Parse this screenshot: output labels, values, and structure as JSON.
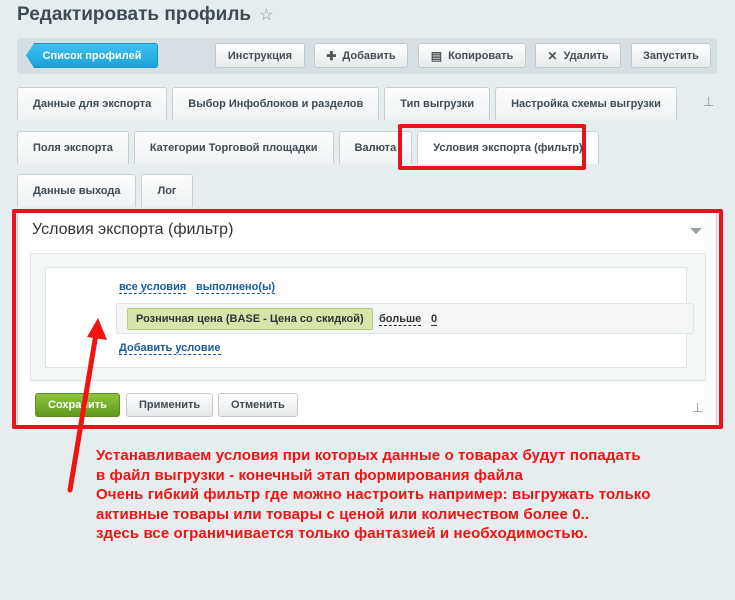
{
  "page": {
    "title": "Редактировать профиль",
    "favorite_icon": "star-icon"
  },
  "toolbar": {
    "profiles_label": "Список профилей",
    "instructions_label": "Инструкция",
    "add_label": "Добавить",
    "add_icon": "plus-icon",
    "copy_label": "Копировать",
    "copy_icon": "copy-icon",
    "delete_label": "Удалить",
    "delete_icon": "close-icon",
    "run_label": "Запустить"
  },
  "tabs_row1": [
    "Данные для экспорта",
    "Выбор Инфоблоков и разделов",
    "Тип выгрузки",
    "Настройка схемы выгрузки"
  ],
  "tabs_row2": [
    "Поля экспорта",
    "Категории Торговой площадки",
    "Валюта",
    "Условия экспорта (фильтр)"
  ],
  "tabs_row3": [
    "Данные выхода",
    "Лог"
  ],
  "pin_icon": "pin-icon",
  "panel": {
    "title": "Условия экспорта (фильтр)",
    "collapse_icon": "chevron-down-icon",
    "filter": {
      "all_conditions": "все условия",
      "fulfilled": "выполнено(ы)",
      "condition_field": "Розничная цена (BASE - Цена со скидкой)",
      "condition_operator": "больше",
      "condition_value": "0",
      "add_condition": "Добавить условие"
    }
  },
  "footer": {
    "save_label": "Сохранить",
    "apply_label": "Применить",
    "cancel_label": "Отменить"
  },
  "annotation": {
    "lines": [
      "Устанавливаем условия при которых данные о товарах будут попадать",
      "в файл выгрузки - конечный этап формирования файла",
      "Очень гибкий фильтр где можно настроить например: выгружать только",
      "активные товары или товары с ценой или количеством более 0..",
      "здесь все ограничивается только фантазией и необходимостью."
    ],
    "color": "#f21212"
  },
  "colors": {
    "accent_blue": "#1aa2d8",
    "save_green": "#6aa626",
    "highlight_red": "#e8121f"
  }
}
